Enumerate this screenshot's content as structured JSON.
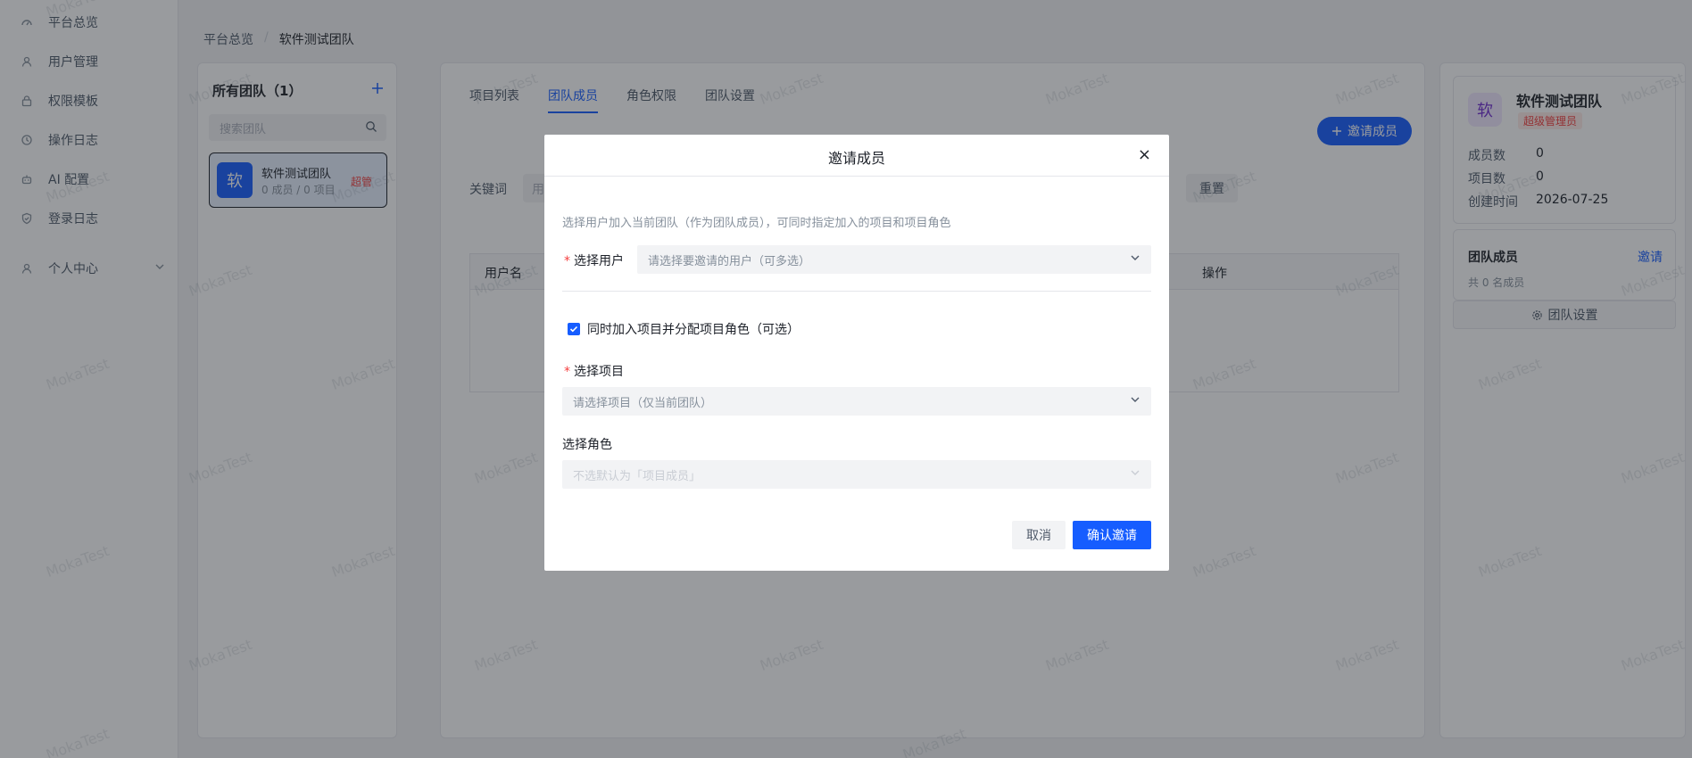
{
  "sidebar": {
    "items": [
      {
        "label": "平台总览",
        "icon": "dashboard-icon"
      },
      {
        "label": "用户管理",
        "icon": "user-icon"
      },
      {
        "label": "权限模板",
        "icon": "lock-icon"
      },
      {
        "label": "操作日志",
        "icon": "history-icon"
      },
      {
        "label": "AI 配置",
        "icon": "robot-icon"
      },
      {
        "label": "登录日志",
        "icon": "shield-icon"
      },
      {
        "label": "个人中心",
        "icon": "user-icon"
      }
    ]
  },
  "breadcrumb": {
    "root": "平台总览",
    "sep": "/",
    "current": "软件测试团队"
  },
  "teams_panel": {
    "title": "所有团队（1）",
    "search_placeholder": "搜索团队",
    "team": {
      "avatar": "软",
      "name": "软件测试团队",
      "meta": "0 成员 / 0 项目",
      "tag": "超管"
    }
  },
  "center": {
    "tabs": [
      "项目列表",
      "团队成员",
      "角色权限",
      "团队设置"
    ],
    "active_tab": 1,
    "invite_button": "邀请成员",
    "keyword_label": "关键词",
    "keyword_placeholder": "用",
    "reset_button": "重置",
    "table_headers": [
      "用户名",
      "操作"
    ]
  },
  "team_info": {
    "avatar": "软",
    "name": "软件测试团队",
    "badge": "超级管理员",
    "rows": [
      {
        "label": "成员数",
        "value": "0"
      },
      {
        "label": "项目数",
        "value": "0"
      },
      {
        "label": "创建时间",
        "value": "2026-07-25"
      }
    ],
    "members_title": "团队成员",
    "members_invite": "邀请",
    "members_count": "共 0 名成员",
    "settings_button": "团队设置"
  },
  "watermark": "MokaTest",
  "modal": {
    "title": "邀请成员",
    "close": "×",
    "description": "选择用户加入当前团队（作为团队成员），可同时指定加入的项目和项目角色",
    "user_label": "选择用户",
    "user_placeholder": "请选择要邀请的用户（可多选）",
    "checkbox_label": "同时加入项目并分配项目角色（可选）",
    "checkbox_checked": true,
    "project_label": "选择项目",
    "project_placeholder": "请选择项目（仅当前团队）",
    "role_label": "选择角色",
    "role_placeholder": "不选默认为「项目成员」",
    "cancel": "取消",
    "confirm": "确认邀请"
  },
  "colors": {
    "primary": "#165dff",
    "danger": "#f53f3f",
    "overlay": "rgba(29,33,41,0.45)"
  }
}
